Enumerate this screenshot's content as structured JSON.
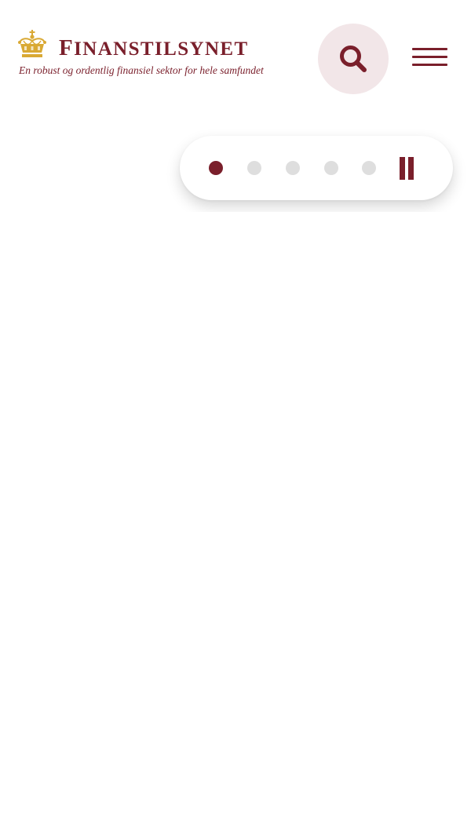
{
  "header": {
    "brand": {
      "first_letter": "F",
      "rest": "INANSTILSYNET",
      "tagline": "En robust og ordentlig finansiel sektor for hele samfundet",
      "logo_icon": "crown-icon",
      "logo_color": "#d9a934"
    },
    "search": {
      "icon": "search-icon",
      "background": "#f2e6e8"
    },
    "menu": {
      "icon": "hamburger-menu-icon"
    }
  },
  "carousel": {
    "slide_count": 5,
    "active_index": 0,
    "pause_icon": "pause-icon"
  },
  "colors": {
    "brand": "#7a1f2b",
    "dot_inactive": "#dedede"
  }
}
